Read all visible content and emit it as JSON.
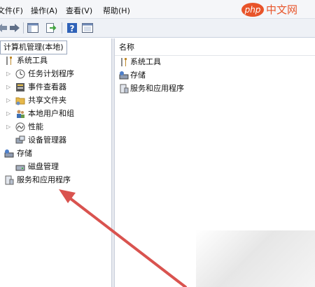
{
  "menubar": {
    "items": [
      "文件(F)",
      "操作(A)",
      "查看(V)",
      "帮助(H)"
    ]
  },
  "toolbar": {
    "buttons": [
      "back-icon",
      "forward-icon",
      "show-hide-console-tree-icon",
      "export-list-icon",
      "help-icon",
      "properties-icon"
    ]
  },
  "tree": {
    "root": "计算机管理(本地)",
    "system_tools": "系统工具",
    "task_scheduler": "任务计划程序",
    "event_viewer": "事件查看器",
    "shared_folders": "共享文件夹",
    "local_users": "本地用户和组",
    "performance": "性能",
    "device_manager": "设备管理器",
    "storage": "存储",
    "disk_management": "磁盘管理",
    "services_apps": "服务和应用程序"
  },
  "list": {
    "column_name": "名称",
    "items": [
      "系统工具",
      "存储",
      "服务和应用程序"
    ]
  },
  "watermark": {
    "php": "php",
    "site": "中文网"
  },
  "colors": {
    "arrow": "#d9534f",
    "watermark_orange": "#e8542a"
  }
}
